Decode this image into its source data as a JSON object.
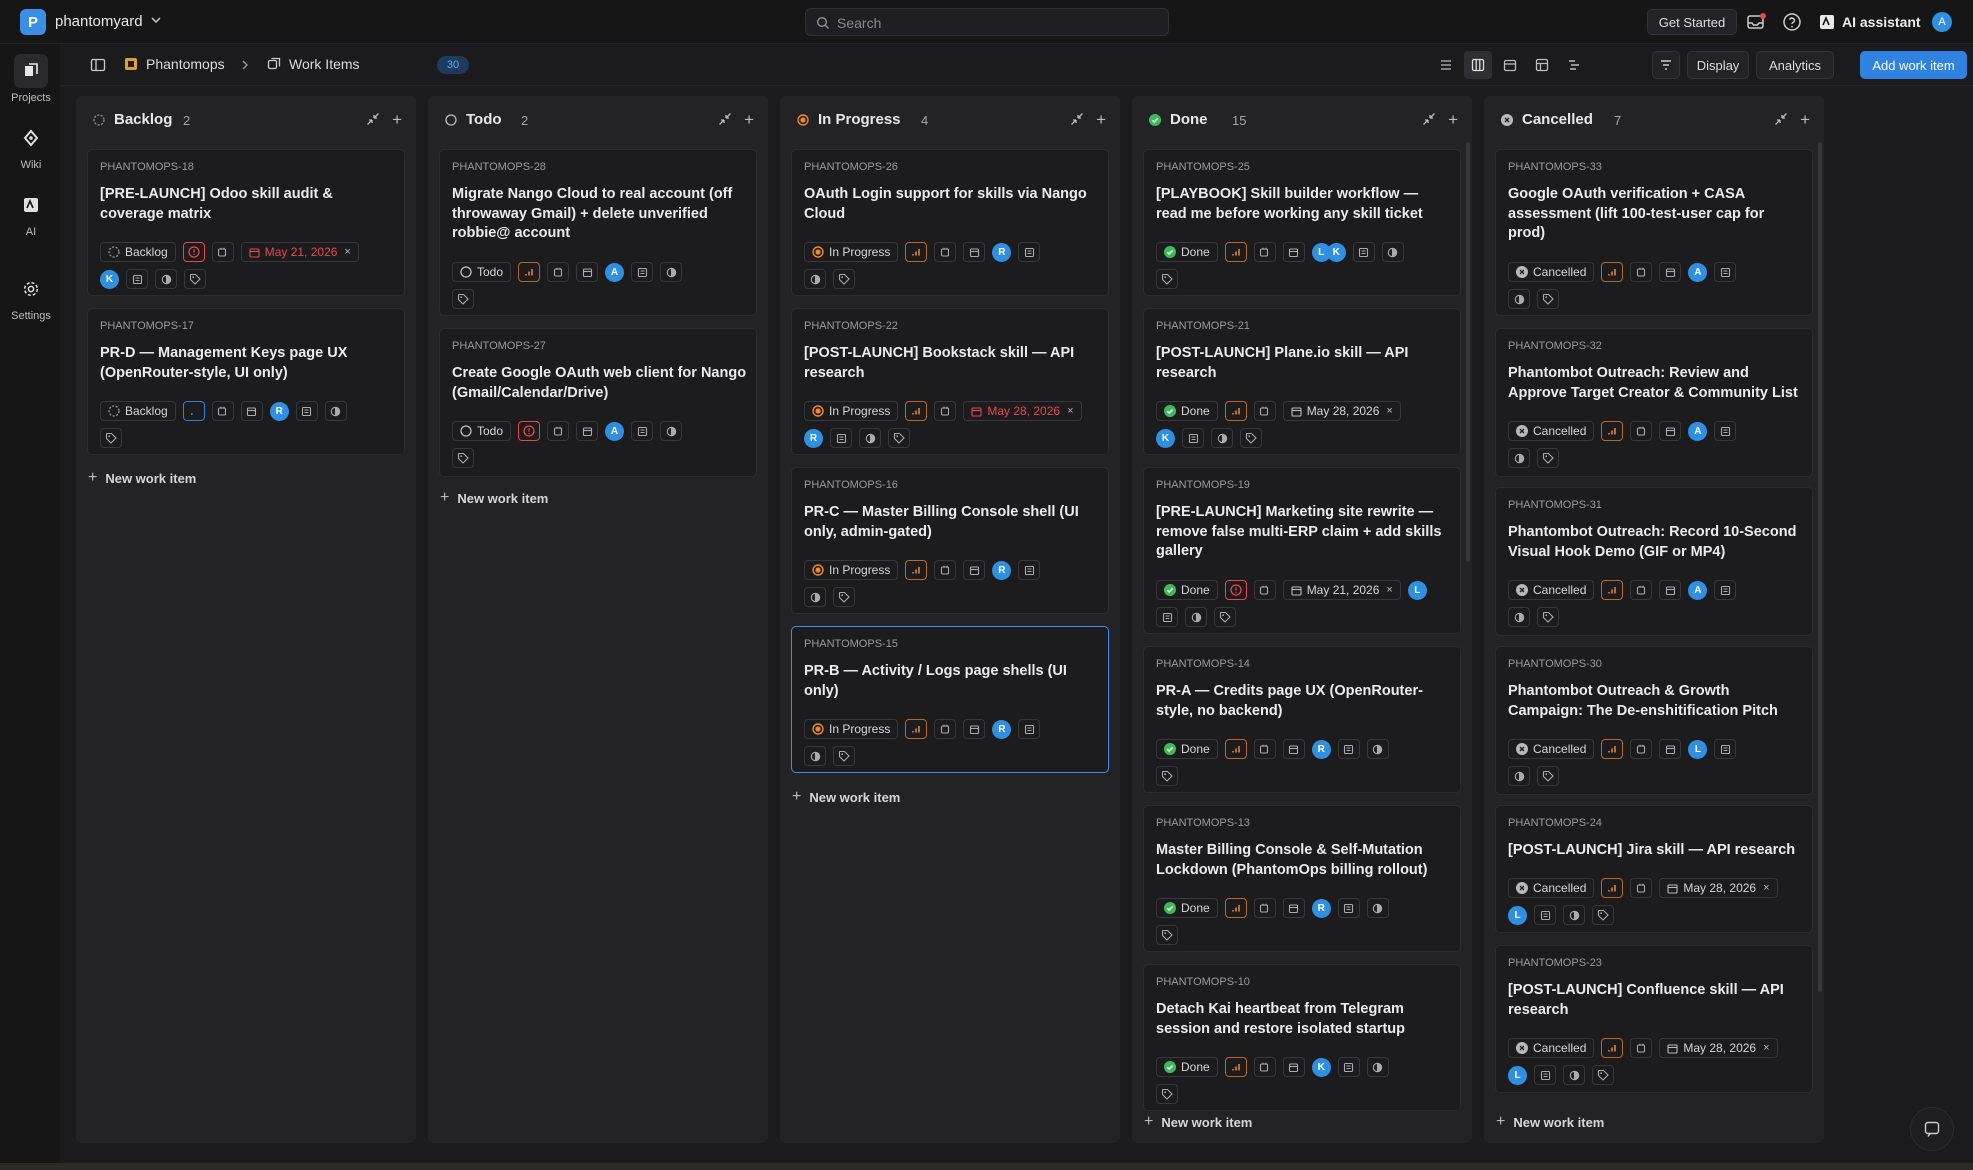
{
  "workspace": {
    "initial": "P",
    "name": "phantomyard"
  },
  "search": {
    "placeholder": "Search"
  },
  "topbar": {
    "get_started": "Get Started",
    "ai_assistant": "AI assistant",
    "user_initial": "A"
  },
  "rail": [
    {
      "label": "Projects"
    },
    {
      "label": "Wiki"
    },
    {
      "label": "AI"
    },
    {
      "label": "Settings"
    }
  ],
  "breadcrumb": {
    "project": "Phantomops",
    "page": "Work Items",
    "count": "30"
  },
  "header": {
    "display": "Display",
    "analytics": "Analytics",
    "add": "Add work item",
    "more": "..."
  },
  "colors": {
    "accent": "#2f82e0",
    "backlog": "#9a9a9a",
    "in_progress": "#f0882a",
    "done": "#3dbb5a",
    "cancelled": "#b8b8b8",
    "urgent": "#e5484d",
    "avatar": "#2f8fe0"
  },
  "new_item_label": "New work item",
  "columns": [
    {
      "title": "Backlog",
      "count": "2",
      "cards": [
        {
          "id": "PHANTOMOPS-18",
          "title": "[PRE-LAUNCH] Odoo skill audit & coverage matrix",
          "state": "Backlog",
          "date": "May 21, 2026",
          "avatars": [
            "K"
          ]
        },
        {
          "id": "PHANTOMOPS-17",
          "title": "PR-D — Management Keys page UX (OpenRouter-style, UI only)",
          "state": "Backlog",
          "avatars": [
            "R"
          ]
        }
      ]
    },
    {
      "title": "Todo",
      "count": "2",
      "cards": [
        {
          "id": "PHANTOMOPS-28",
          "title": "Migrate Nango Cloud to real account (off throwaway Gmail) + delete unverified robbie@ account",
          "state": "Todo",
          "avatars": [
            "A"
          ]
        },
        {
          "id": "PHANTOMOPS-27",
          "title": "Create Google OAuth web client for Nango (Gmail/Calendar/Drive)",
          "state": "Todo",
          "avatars": [
            "A"
          ]
        }
      ]
    },
    {
      "title": "In Progress",
      "count": "4",
      "cards": [
        {
          "id": "PHANTOMOPS-26",
          "title": "OAuth Login support for skills via Nango Cloud",
          "state": "In Progress",
          "avatars": [
            "R"
          ]
        },
        {
          "id": "PHANTOMOPS-22",
          "title": "[POST-LAUNCH] Bookstack skill — API research",
          "state": "In Progress",
          "date": "May 28, 2026",
          "avatars": [
            "R"
          ]
        },
        {
          "id": "PHANTOMOPS-16",
          "title": "PR-C — Master Billing Console shell (UI only, admin-gated)",
          "state": "In Progress",
          "avatars": [
            "R"
          ]
        },
        {
          "id": "PHANTOMOPS-15",
          "title": "PR-B — Activity / Logs page shells (UI only)",
          "state": "In Progress",
          "avatars": [
            "R"
          ]
        }
      ]
    },
    {
      "title": "Done",
      "count": "15",
      "cards": [
        {
          "id": "PHANTOMOPS-25",
          "title": "[PLAYBOOK] Skill builder workflow — read me before working any skill ticket",
          "state": "Done",
          "avatars": [
            "L",
            "K"
          ]
        },
        {
          "id": "PHANTOMOPS-21",
          "title": "[POST-LAUNCH] Plane.io skill — API research",
          "state": "Done",
          "date": "May 28, 2026",
          "avatars": [
            "K"
          ]
        },
        {
          "id": "PHANTOMOPS-19",
          "title": "[PRE-LAUNCH] Marketing site rewrite — remove false multi-ERP claim + add skills gallery",
          "state": "Done",
          "date": "May 21, 2026",
          "avatars": [
            "L"
          ]
        },
        {
          "id": "PHANTOMOPS-14",
          "title": "PR-A — Credits page UX (OpenRouter-style, no backend)",
          "state": "Done",
          "avatars": [
            "R"
          ]
        },
        {
          "id": "PHANTOMOPS-13",
          "title": "Master Billing Console & Self-Mutation Lockdown (PhantomOps billing rollout)",
          "state": "Done",
          "avatars": [
            "R"
          ]
        },
        {
          "id": "PHANTOMOPS-10",
          "title": "Detach Kai heartbeat from Telegram session and restore isolated startup",
          "state": "Done",
          "avatars": [
            "K"
          ]
        }
      ]
    },
    {
      "title": "Cancelled",
      "count": "7",
      "cards": [
        {
          "id": "PHANTOMOPS-33",
          "title": "Google OAuth verification + CASA assessment (lift 100-test-user cap for prod)",
          "state": "Cancelled",
          "avatars": [
            "A"
          ]
        },
        {
          "id": "PHANTOMOPS-32",
          "title": "Phantombot Outreach: Review and Approve Target Creator & Community List",
          "state": "Cancelled",
          "avatars": [
            "A"
          ]
        },
        {
          "id": "PHANTOMOPS-31",
          "title": "Phantombot Outreach: Record 10-Second Visual Hook Demo (GIF or MP4)",
          "state": "Cancelled",
          "avatars": [
            "A"
          ]
        },
        {
          "id": "PHANTOMOPS-30",
          "title": "Phantombot Outreach & Growth Campaign: The De-enshitification Pitch",
          "state": "Cancelled",
          "avatars": [
            "L"
          ]
        },
        {
          "id": "PHANTOMOPS-24",
          "title": "[POST-LAUNCH] Jira skill — API research",
          "state": "Cancelled",
          "date": "May 28, 2026",
          "avatars": [
            "L"
          ]
        },
        {
          "id": "PHANTOMOPS-23",
          "title": "[POST-LAUNCH] Confluence skill — API research",
          "state": "Cancelled",
          "date": "May 28, 2026",
          "avatars": [
            "L"
          ]
        }
      ]
    }
  ]
}
